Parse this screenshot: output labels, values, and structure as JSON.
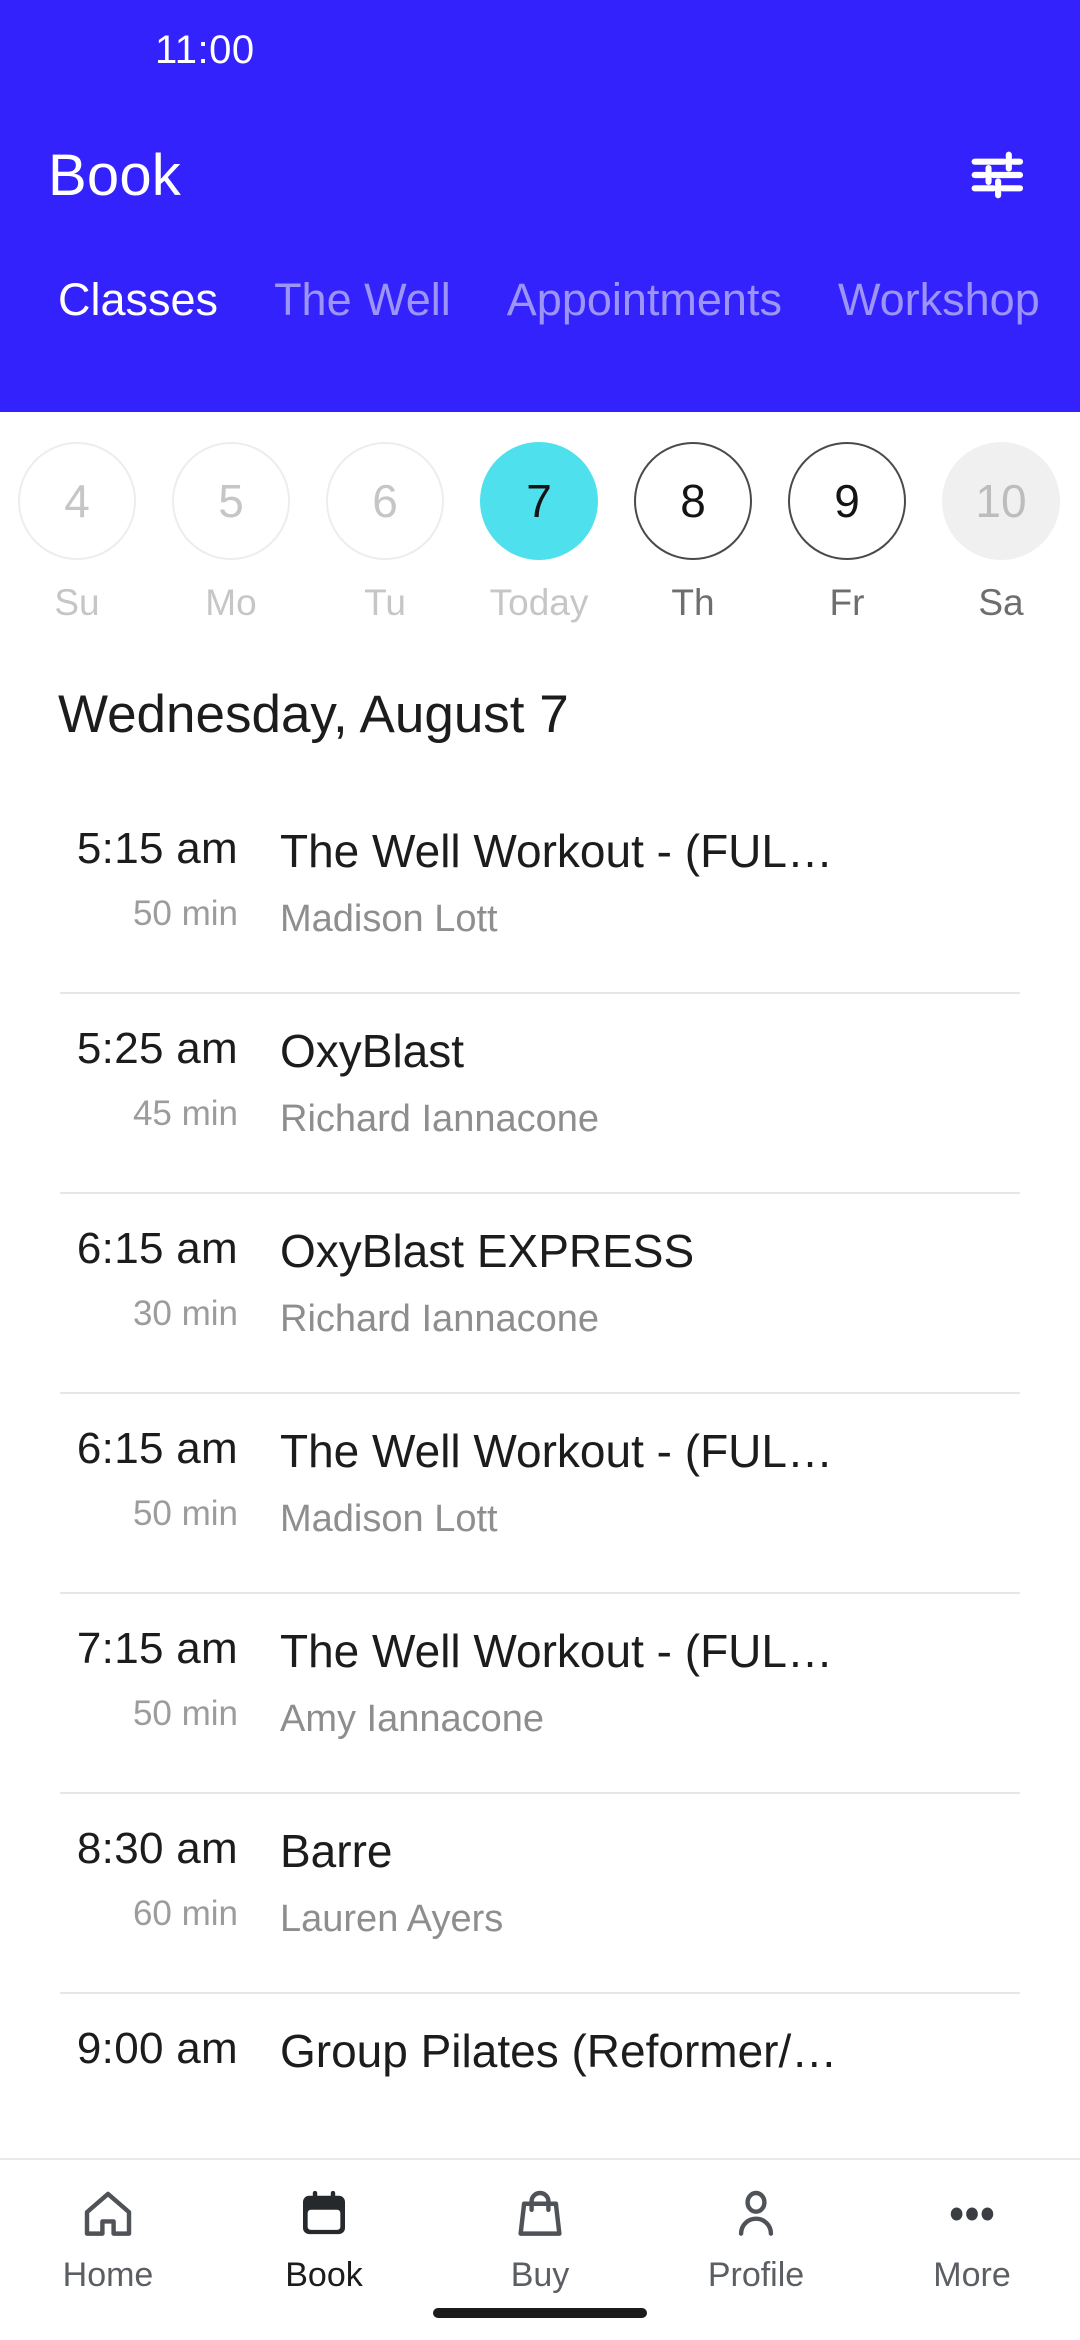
{
  "colors": {
    "header_blue": "#3322FC",
    "tab_inactive": "#9C94F7",
    "today_cyan": "#4FE0EE",
    "divider": "#E6E6E6",
    "muted_text": "#9C9C9C"
  },
  "status_bar": {
    "time": "11:00"
  },
  "app_bar": {
    "title": "Book",
    "filter_icon": "tune-icon"
  },
  "tabs": [
    {
      "label": "Classes",
      "active": true
    },
    {
      "label": "The Well",
      "active": false
    },
    {
      "label": "Appointments",
      "active": false
    },
    {
      "label": "Workshop",
      "active": false
    }
  ],
  "date_strip": [
    {
      "day": "4",
      "weekday": "Su",
      "state": "past"
    },
    {
      "day": "5",
      "weekday": "Mo",
      "state": "past"
    },
    {
      "day": "6",
      "weekday": "Tu",
      "state": "past"
    },
    {
      "day": "7",
      "weekday": "Today",
      "state": "today"
    },
    {
      "day": "8",
      "weekday": "Th",
      "state": "future"
    },
    {
      "day": "9",
      "weekday": "Fr",
      "state": "future"
    },
    {
      "day": "10",
      "weekday": "Sa",
      "state": "muted"
    }
  ],
  "schedule": {
    "date_heading": "Wednesday, August 7",
    "classes": [
      {
        "time": "5:15 am",
        "duration": "50 min",
        "name": "The Well Workout - (FUL…",
        "instructor": "Madison Lott"
      },
      {
        "time": "5:25 am",
        "duration": "45 min",
        "name": "OxyBlast",
        "instructor": "Richard Iannacone"
      },
      {
        "time": "6:15 am",
        "duration": "30 min",
        "name": "OxyBlast EXPRESS",
        "instructor": "Richard Iannacone"
      },
      {
        "time": "6:15 am",
        "duration": "50 min",
        "name": "The Well Workout - (FUL…",
        "instructor": "Madison Lott"
      },
      {
        "time": "7:15 am",
        "duration": "50 min",
        "name": "The Well Workout - (FUL…",
        "instructor": "Amy Iannacone"
      },
      {
        "time": "8:30 am",
        "duration": "60 min",
        "name": "Barre",
        "instructor": "Lauren Ayers"
      },
      {
        "time": "9:00 am",
        "duration": "",
        "name": "Group Pilates (Reformer/…",
        "instructor": ""
      }
    ]
  },
  "bottom_nav": [
    {
      "label": "Home",
      "icon": "home-icon",
      "active": false
    },
    {
      "label": "Book",
      "icon": "calendar-icon",
      "active": true
    },
    {
      "label": "Buy",
      "icon": "bag-icon",
      "active": false
    },
    {
      "label": "Profile",
      "icon": "person-icon",
      "active": false
    },
    {
      "label": "More",
      "icon": "ellipsis-icon",
      "active": false
    }
  ]
}
